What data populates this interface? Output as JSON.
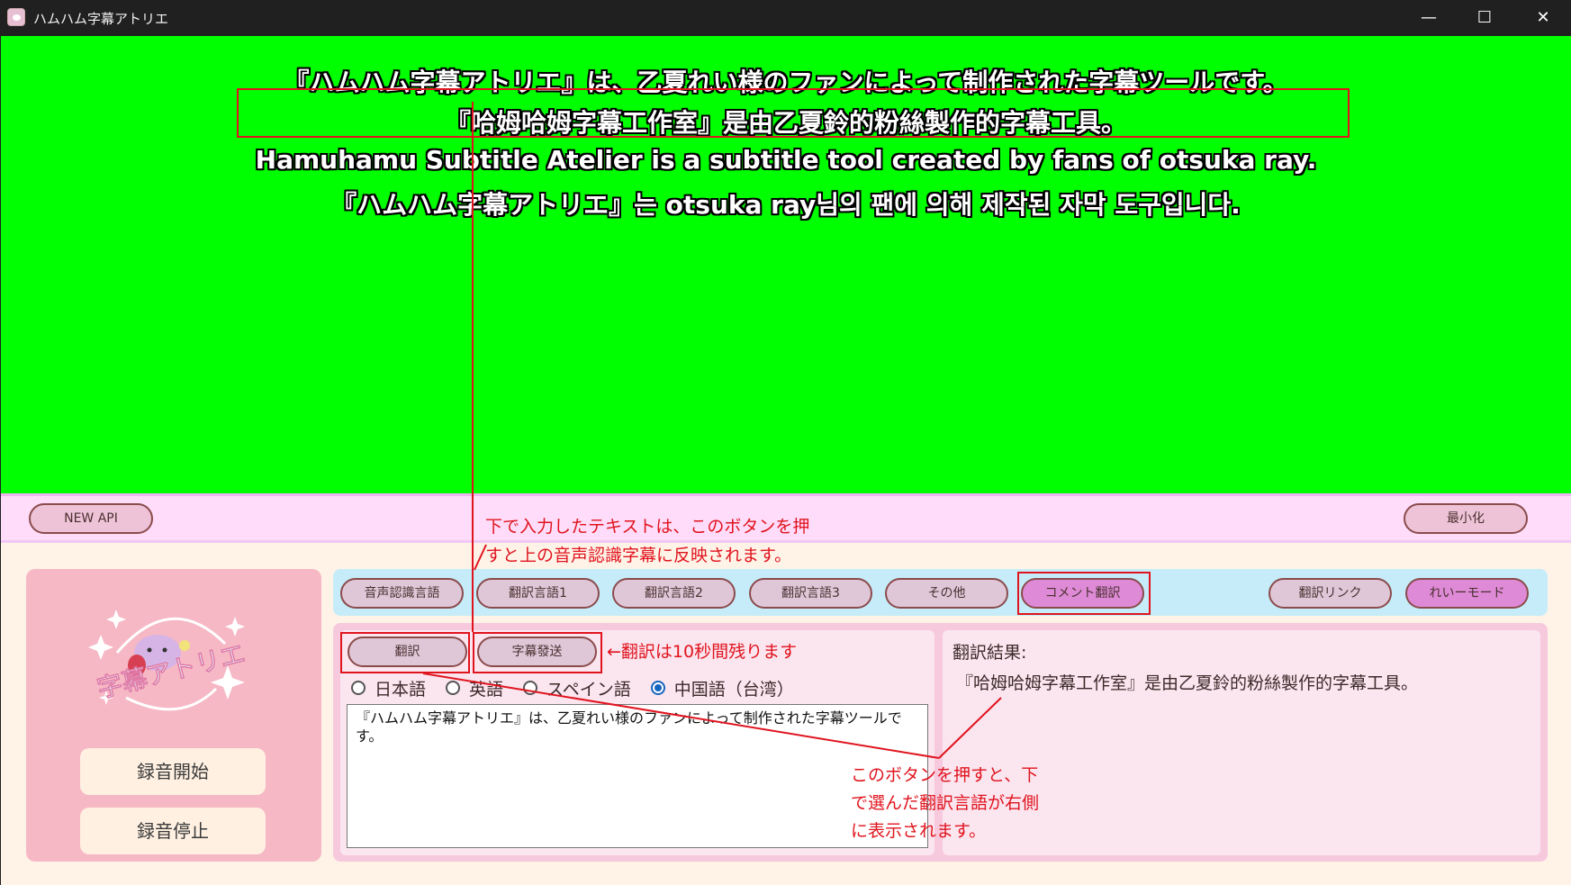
{
  "window": {
    "title": "ハムハム字幕アトリエ",
    "controls": {
      "minimize": "—",
      "maximize": "☐",
      "close": "✕"
    }
  },
  "subtitles": {
    "line1": "『ハムハム字幕アトリエ』は、乙夏れい様のファンによって制作された字幕ツールです。",
    "line2": "『哈姆哈姆字幕工作室』是由乙夏鈴的粉絲製作的字幕工具。",
    "line3": "Hamuhamu Subtitle Atelier is a subtitle tool created by fans of otsuka ray.",
    "line4": "『ハムハム字幕アトリエ』는 otsuka ray님의 팬에 의해 제작된 자막 도구입니다."
  },
  "strip": {
    "new_api": "NEW API",
    "minimize": "最小化"
  },
  "left_panel": {
    "logo_text": "字幕アトリエ",
    "record_start": "録音開始",
    "record_stop": "録音停止"
  },
  "tabs": [
    {
      "label": "音声認識言語"
    },
    {
      "label": "翻訳言語1"
    },
    {
      "label": "翻訳言語2"
    },
    {
      "label": "翻訳言語3"
    },
    {
      "label": "その他"
    },
    {
      "label": "コメント翻訳"
    },
    {
      "label": "翻訳リンク"
    },
    {
      "label": "れいーモード"
    }
  ],
  "actions": {
    "translate": "翻訳",
    "send_subtitle": "字幕發送"
  },
  "languages": [
    {
      "label": "日本語",
      "selected": false
    },
    {
      "label": "英語",
      "selected": false
    },
    {
      "label": "スペイン語",
      "selected": false
    },
    {
      "label": "中国語（台湾）",
      "selected": true
    }
  ],
  "input_text": "『ハムハム字幕アトリエ』は、乙夏れい様のファンによって制作された字幕ツールです。",
  "result": {
    "label": "翻訳結果:",
    "text": "『哈姆哈姆字幕工作室』是由乙夏鈴的粉絲製作的字幕工具。"
  },
  "annotations": {
    "top_line1": "下で入力したテキストは、このボタンを押",
    "top_line2": "すと上の音声認識字幕に反映されます。",
    "middle": "←翻訳は10秒間残ります",
    "bottom_line1": "このボタンを押すと、下",
    "bottom_line2": "で選んだ翻訳言語が右側",
    "bottom_line3": "に表示されます。"
  },
  "colors": {
    "stage": "#00ff00",
    "annotation": "#e0141e",
    "active_tab": "#df8ad6"
  }
}
